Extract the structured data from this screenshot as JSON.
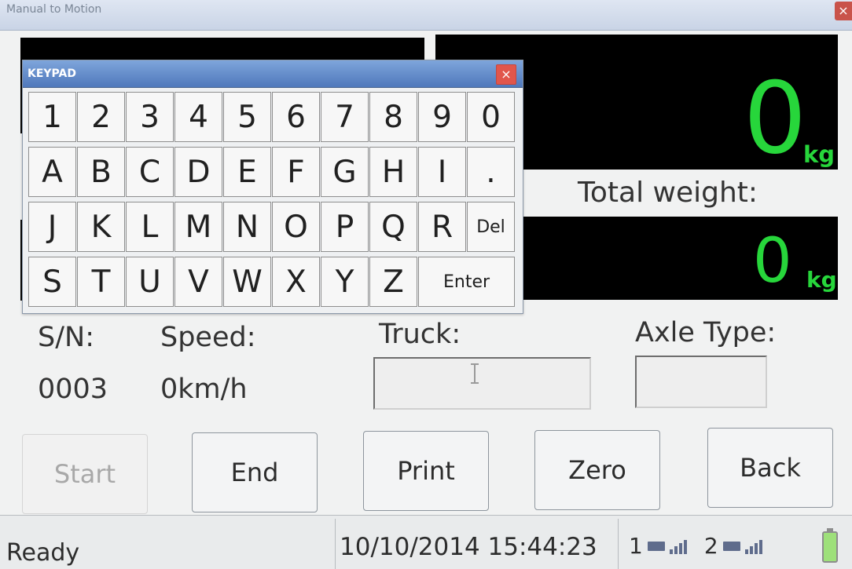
{
  "window": {
    "title": "Manual to Motion",
    "close_icon": "close-icon"
  },
  "display": {
    "current_weight": "0",
    "current_unit": "kg",
    "total_weight_label": "Total weight:",
    "total_weight": "0",
    "total_unit": "kg"
  },
  "keypad": {
    "title": "KEYPAD",
    "close_icon": "close-icon",
    "rows": [
      [
        "1",
        "2",
        "3",
        "4",
        "5",
        "6",
        "7",
        "8",
        "9",
        "0"
      ],
      [
        "A",
        "B",
        "C",
        "D",
        "E",
        "F",
        "G",
        "H",
        "I",
        "."
      ],
      [
        "J",
        "K",
        "L",
        "M",
        "N",
        "O",
        "P",
        "Q",
        "R",
        "Del"
      ],
      [
        "S",
        "T",
        "U",
        "V",
        "W",
        "X",
        "Y",
        "Z",
        "Enter"
      ]
    ]
  },
  "info": {
    "sn_label": "S/N:",
    "sn_value": "0003",
    "speed_label": "Speed:",
    "speed_value": "0km/h",
    "truck_label": "Truck:",
    "truck_value": "",
    "axle_type_label": "Axle Type:",
    "axle_type_value": ""
  },
  "buttons": {
    "start": "Start",
    "end": "End",
    "print": "Print",
    "zero": "Zero",
    "back": "Back"
  },
  "status": {
    "state": "Ready",
    "datetime": "10/10/2014 15:44:23",
    "device_1": "1",
    "device_2": "2"
  },
  "colors": {
    "weight_green": "#27d63b",
    "keypad_title_blue": "#4f78bb",
    "display_black": "#000000"
  }
}
